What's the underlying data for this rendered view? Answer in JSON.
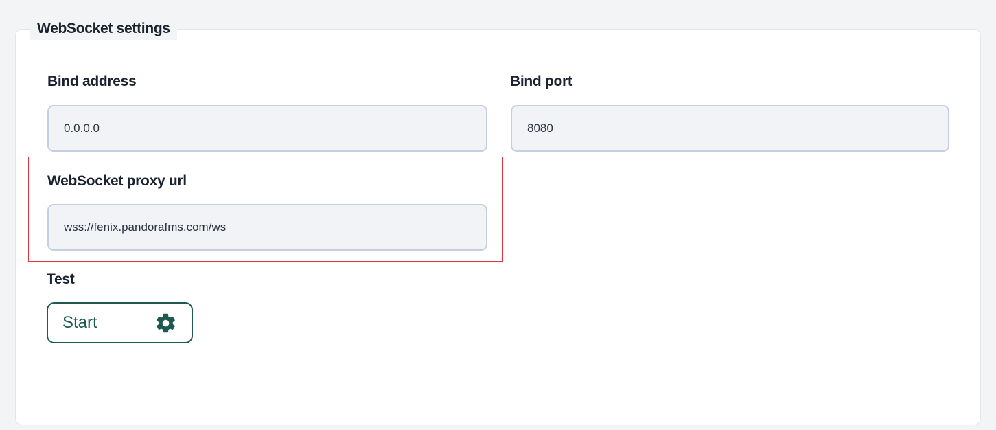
{
  "section": {
    "legend": "WebSocket settings"
  },
  "fields": {
    "bind_address": {
      "label": "Bind address",
      "value": "0.0.0.0"
    },
    "bind_port": {
      "label": "Bind port",
      "value": "8080"
    },
    "proxy_url": {
      "label": "WebSocket proxy url",
      "value": "wss://fenix.pandorafms.com/ws"
    }
  },
  "test": {
    "label": "Test",
    "button_label": "Start",
    "button_icon": "gear-icon"
  },
  "colors": {
    "accent": "#1e5a52",
    "highlight_border": "#e0313d",
    "input_border": "#c4cfdf",
    "input_background": "#f2f3f6"
  }
}
